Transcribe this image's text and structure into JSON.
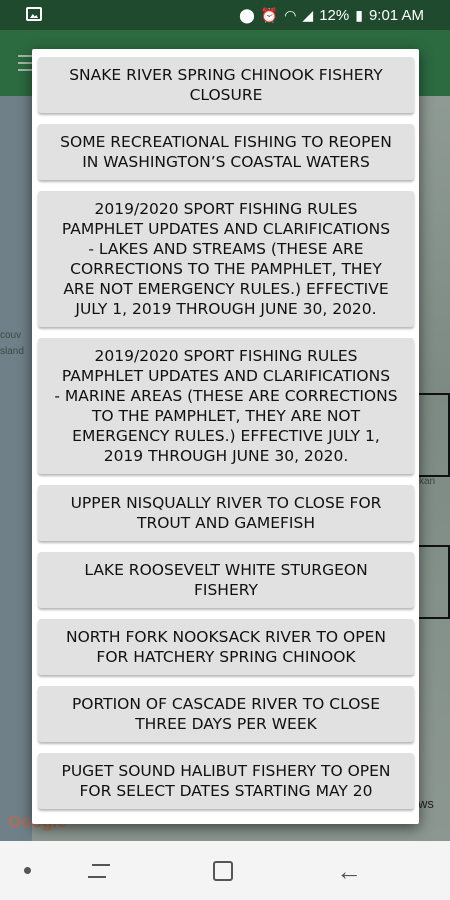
{
  "status_bar": {
    "battery": "12%",
    "time": "9:01 AM",
    "icons": [
      "image-icon",
      "location-icon",
      "alarm-icon",
      "wifi-icon",
      "signal-icon",
      "battery-icon"
    ]
  },
  "map": {
    "labels": [
      "couv",
      "sland",
      "kan",
      "ws"
    ],
    "attribution": "Google"
  },
  "dialog": {
    "items": [
      {
        "label": "SNAKE RIVER SPRING CHINOOK FISHERY\nCLOSURE"
      },
      {
        "label": "SOME RECREATIONAL FISHING TO REOPEN\nIN WASHINGTON’S COASTAL WATERS"
      },
      {
        "label": "2019/2020 SPORT FISHING RULES\nPAMPHLET UPDATES AND CLARIFICATIONS\n- LAKES AND STREAMS  (THESE ARE\nCORRECTIONS TO THE PAMPHLET, THEY\nARE NOT EMERGENCY RULES.) EFFECTIVE\nJULY 1, 2019 THROUGH JUNE 30, 2020."
      },
      {
        "label": "2019/2020 SPORT FISHING RULES\nPAMPHLET UPDATES AND CLARIFICATIONS\n- MARINE AREAS (THESE ARE CORRECTIONS\nTO THE PAMPHLET, THEY ARE NOT\nEMERGENCY RULES.) EFFECTIVE JULY 1,\n2019 THROUGH JUNE 30, 2020."
      },
      {
        "label": "UPPER NISQUALLY RIVER TO CLOSE FOR\nTROUT AND GAMEFISH"
      },
      {
        "label": "LAKE ROOSEVELT WHITE STURGEON\nFISHERY"
      },
      {
        "label": "NORTH FORK NOOKSACK RIVER TO OPEN\nFOR HATCHERY SPRING CHINOOK"
      },
      {
        "label": "PORTION OF CASCADE RIVER TO CLOSE\nTHREE DAYS PER WEEK"
      },
      {
        "label": "PUGET SOUND HALIBUT FISHERY TO OPEN\nFOR SELECT DATES STARTING MAY 20"
      }
    ]
  },
  "colors": {
    "status_bar": "#1f4a2e",
    "app_header": "#2c6a40",
    "item_background": "#e1e1e1",
    "dialog_background": "#ffffff"
  }
}
